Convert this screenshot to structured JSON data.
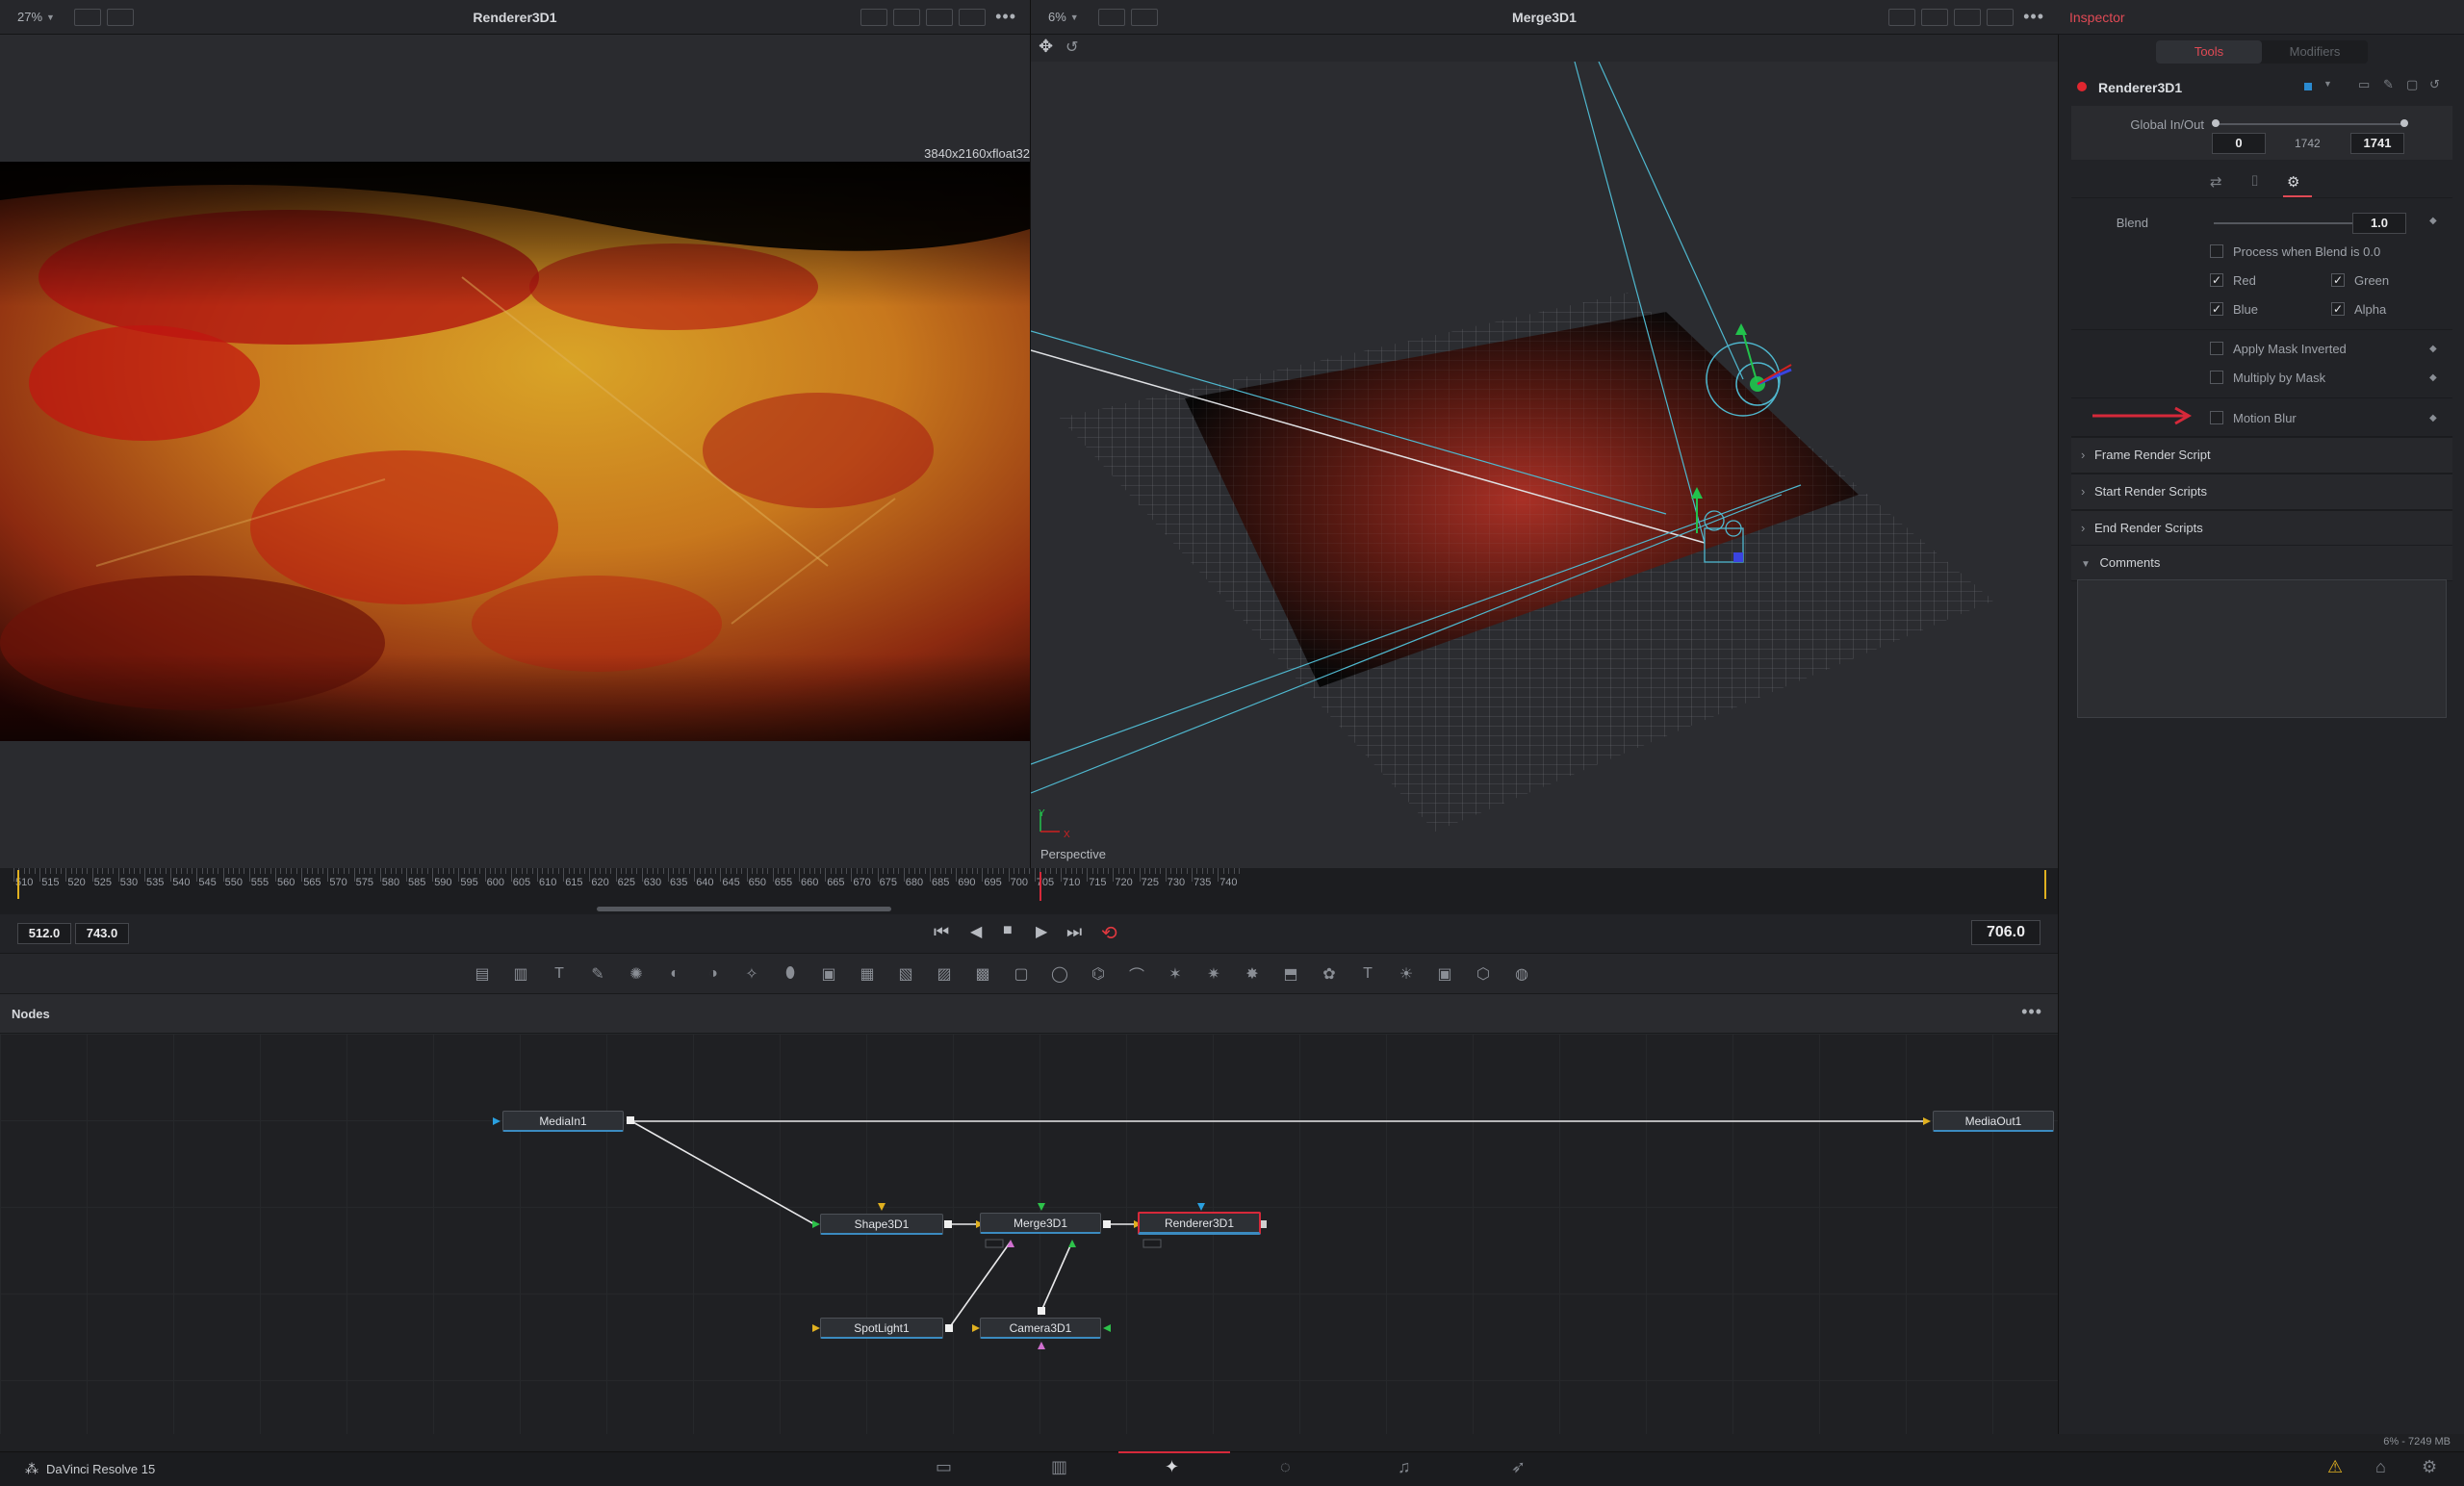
{
  "left_viewer": {
    "zoom": "27%",
    "title": "Renderer3D1",
    "resolution": "3840x2160xfloat32"
  },
  "right_viewer": {
    "zoom": "6%",
    "title": "Merge3D1",
    "view_label": "Perspective",
    "axis_y": "Y",
    "axis_x": "X"
  },
  "timeline": {
    "ticks": [
      "510",
      "515",
      "520",
      "525",
      "530",
      "535",
      "540",
      "545",
      "550",
      "555",
      "560",
      "565",
      "570",
      "575",
      "580",
      "585",
      "590",
      "595",
      "600",
      "605",
      "610",
      "615",
      "620",
      "625",
      "630",
      "635",
      "640",
      "645",
      "650",
      "655",
      "660",
      "665",
      "670",
      "675",
      "680",
      "685",
      "690",
      "695",
      "700",
      "705",
      "710",
      "715",
      "720",
      "725",
      "730",
      "735",
      "740"
    ],
    "playhead_frame": 706,
    "start_field": "512.0",
    "end_field": "743.0",
    "current_frame": "706.0"
  },
  "nodes_panel": {
    "title": "Nodes",
    "nodes": {
      "mediain": "MediaIn1",
      "mediaout": "MediaOut1",
      "shape": "Shape3D1",
      "merge": "Merge3D1",
      "renderer": "Renderer3D1",
      "spotlight": "SpotLight1",
      "camera": "Camera3D1"
    }
  },
  "inspector": {
    "title": "Inspector",
    "tabs": [
      "Tools",
      "Modifiers"
    ],
    "tool_name": "Renderer3D1",
    "global_inout_label": "Global In/Out",
    "global_in": "0",
    "global_mid": "1742",
    "global_out": "1741",
    "blend_label": "Blend",
    "blend_value": "1.0",
    "blend_fraction": 1.0,
    "process_label": "Process when Blend is 0.0",
    "channels": [
      {
        "label": "Red",
        "checked": true
      },
      {
        "label": "Green",
        "checked": true
      },
      {
        "label": "Blue",
        "checked": true
      },
      {
        "label": "Alpha",
        "checked": true
      }
    ],
    "apply_mask_inverted": "Apply Mask Inverted",
    "multiply_by_mask": "Multiply by Mask",
    "motion_blur": "Motion Blur",
    "sections": [
      "Frame Render Script",
      "Start Render Scripts",
      "End Render Scripts"
    ],
    "comments": "Comments"
  },
  "status": {
    "app": "DaVinci Resolve 15",
    "memory": "6% - 7249 MB"
  },
  "colors": {
    "accent_red": "#d6293a",
    "link_blue": "#3b8bc0",
    "panel_bg": "#26272b"
  }
}
